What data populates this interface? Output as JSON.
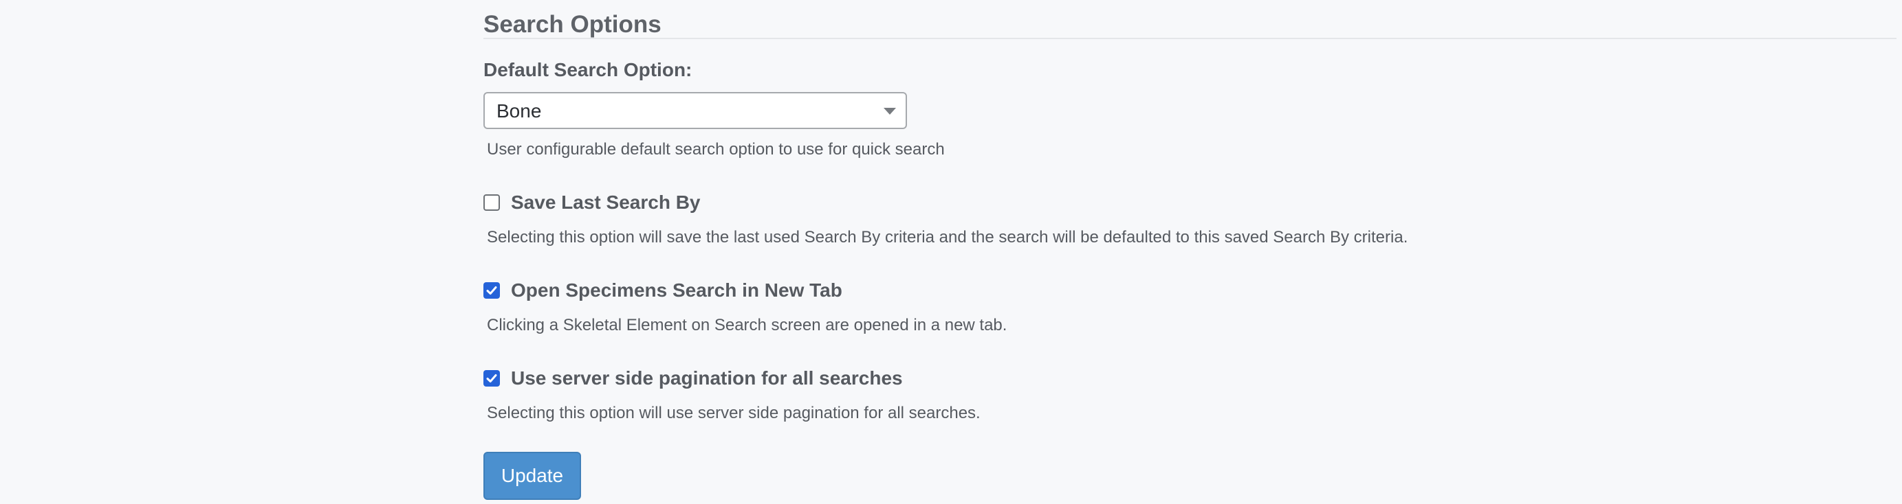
{
  "section": {
    "title": "Search Options"
  },
  "default_search": {
    "label": "Default Search Option:",
    "selected_value": "Bone",
    "help": "User configurable default search option to use for quick search"
  },
  "options": [
    {
      "label": "Save Last Search By",
      "checked": false,
      "help": "Selecting this option will save the last used Search By criteria and the search will be defaulted to this saved Search By criteria."
    },
    {
      "label": "Open Specimens Search in New Tab",
      "checked": true,
      "help": "Clicking a Skeletal Element on Search screen are opened in a new tab."
    },
    {
      "label": "Use server side pagination for all searches",
      "checked": true,
      "help": "Selecting this option will use server side pagination for all searches."
    }
  ],
  "actions": {
    "update_label": "Update"
  },
  "colors": {
    "checkbox_checked": "#2563d9",
    "button_primary": "#4b90cf"
  },
  "icons": {
    "select_caret": "chevron-down-icon",
    "checkmark": "checkmark-icon"
  }
}
